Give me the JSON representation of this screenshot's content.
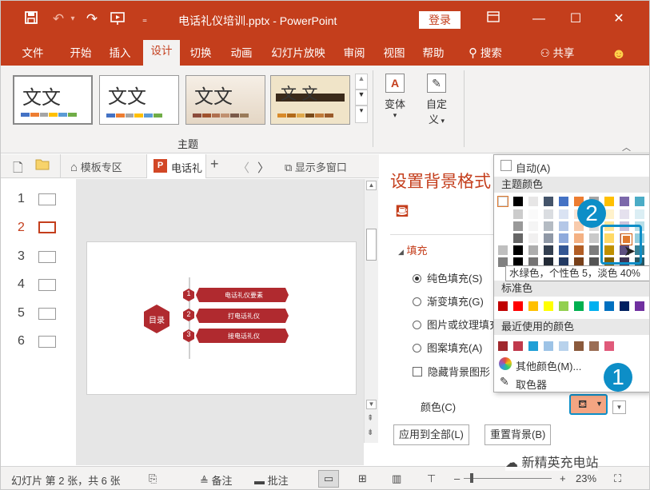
{
  "window": {
    "title": "电话礼仪培训.pptx - PowerPoint",
    "login_label": "登录"
  },
  "menu": {
    "items": [
      "文件",
      "开始",
      "插入",
      "设计",
      "切换",
      "动画",
      "幻灯片放映",
      "审阅",
      "视图",
      "帮助",
      "搜索",
      "共享"
    ],
    "active": "设计"
  },
  "ribbon": {
    "theme_glyph": "文文",
    "theme_glyph_alt": "文 文",
    "group_theme_label": "主题",
    "variant_label": "变体",
    "custom_label_1": "自定",
    "custom_label_2": "义"
  },
  "tabs": {
    "template_zone": "模板专区",
    "ppt_tab": "电话礼",
    "multi_window": "显示多窗口"
  },
  "thumbnails": [
    "1",
    "2",
    "3",
    "4",
    "5",
    "6"
  ],
  "selected_slide": "2",
  "slide": {
    "hex_label": "目录",
    "items": [
      {
        "num": "1",
        "text": "电话礼仪要素"
      },
      {
        "num": "2",
        "text": "打电话礼仪"
      },
      {
        "num": "3",
        "text": "接电话礼仪"
      }
    ]
  },
  "format_pane": {
    "title": "设置背景格式",
    "section": "填充",
    "options": [
      "纯色填充(S)",
      "渐变填充(G)",
      "图片或纹理填充",
      "图案填充(A)"
    ],
    "hide_bg": "隐藏背景图形",
    "color_label": "颜色(C)",
    "apply_all": "应用到全部(L)",
    "reset_bg": "重置背景(B)"
  },
  "color_popup": {
    "auto": "自动(A)",
    "theme_colors_label": "主题颜色",
    "standard_colors_label": "标准色",
    "recent_colors_label": "最近使用的颜色",
    "more_colors": "其他颜色(M)...",
    "eyedropper": "取色器",
    "tooltip": "水绿色，个性色 5，淡色 40%",
    "theme_colors": [
      "#ffffff",
      "#000000",
      "#e7e6e6",
      "#44546a",
      "#4472c4",
      "#ed7d31",
      "#a5a5a5",
      "#ffc000",
      "#7b68aa",
      "#4bacc6"
    ],
    "standard_colors": [
      "#c00000",
      "#ff0000",
      "#ffc000",
      "#ffff00",
      "#92d050",
      "#00b050",
      "#00b0f0",
      "#0070c0",
      "#002060",
      "#7030a0"
    ],
    "recent_colors": [
      "#a0282d",
      "#c0394b",
      "#1f9fd6",
      "#9dc3e6",
      "#b8d2ec",
      "#8b5a3c",
      "#9b6e55",
      "#e05a7a"
    ]
  },
  "callouts": [
    "1",
    "2"
  ],
  "status": {
    "slide_info": "幻灯片 第 2 张，共 6 张",
    "notes": "备注",
    "comments": "批注",
    "zoom": "23%",
    "watermark": "新精英充电站"
  }
}
